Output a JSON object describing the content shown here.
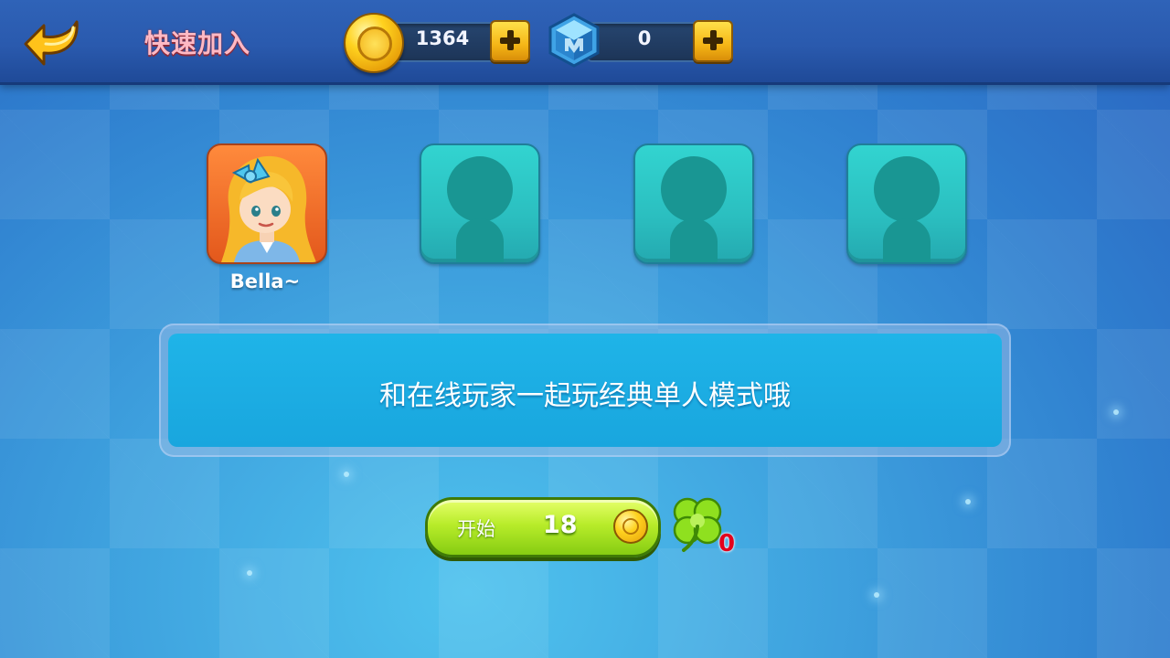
{
  "header": {
    "title": "快速加入",
    "coins": {
      "value": "1364",
      "icon": "gold-coin-icon"
    },
    "gems": {
      "value": "0",
      "icon": "blue-gem-icon"
    }
  },
  "players": [
    {
      "name": "Bella~",
      "state": "occupied"
    },
    {
      "name": "",
      "state": "empty"
    },
    {
      "name": "",
      "state": "empty"
    },
    {
      "name": "",
      "state": "empty"
    }
  ],
  "info": {
    "message": "和在线玩家一起玩经典单人模式哦"
  },
  "start": {
    "label": "开始",
    "cost": "18",
    "cost_icon": "gold-coin-icon"
  },
  "clover": {
    "count": "0",
    "icon": "four-leaf-clover-icon"
  },
  "colors": {
    "accent_title": "#ffb9c4",
    "button_green": "#b8ec2a",
    "clover_count": "#e3001c"
  }
}
